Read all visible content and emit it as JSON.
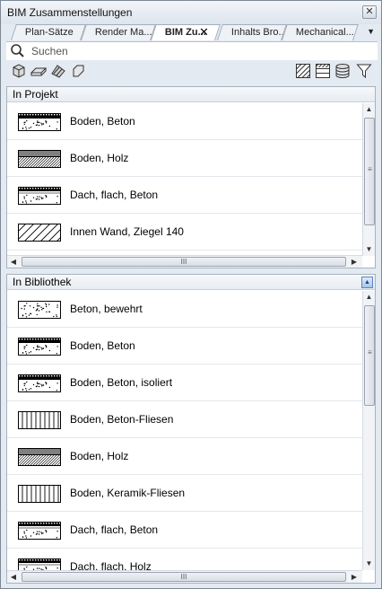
{
  "window": {
    "title": "BIM Zusammenstellungen",
    "close_glyph": "✕"
  },
  "tabs": [
    {
      "label": "Plan-Sätze"
    },
    {
      "label": "Render Ma..."
    },
    {
      "label": "BIM Zu..."
    },
    {
      "label": "Inhalts Bro..."
    },
    {
      "label": "Mechanical..."
    }
  ],
  "tab_close_glyph": "✕",
  "tab_menu_glyph": "▼",
  "search": {
    "placeholder": "Suchen"
  },
  "toolbar": {
    "left_icons": [
      "wall-icon",
      "slab-icon",
      "roof-icon",
      "custom-shape-icon"
    ],
    "right_icons": [
      "hatch-icon",
      "layers-icon",
      "database-icon",
      "filter-icon"
    ]
  },
  "project_panel": {
    "header": "In Projekt",
    "items": [
      {
        "label": "Boden, Beton",
        "pattern": "concrete-floor"
      },
      {
        "label": "Boden, Holz",
        "pattern": "wood-floor"
      },
      {
        "label": "Dach, flach, Beton",
        "pattern": "flat-roof"
      },
      {
        "label": "Innen Wand, Ziegel 140",
        "pattern": "brick-wall"
      }
    ]
  },
  "library_panel": {
    "header": "In Bibliothek",
    "collapse_glyph": "▲",
    "items": [
      {
        "label": "Beton, bewehrt",
        "pattern": "concrete"
      },
      {
        "label": "Boden, Beton",
        "pattern": "concrete-floor"
      },
      {
        "label": "Boden, Beton, isoliert",
        "pattern": "concrete-floor"
      },
      {
        "label": "Boden, Beton-Fliesen",
        "pattern": "tiles"
      },
      {
        "label": "Boden, Holz",
        "pattern": "wood-floor"
      },
      {
        "label": "Boden, Keramik-Fliesen",
        "pattern": "tiles"
      },
      {
        "label": "Dach, flach, Beton",
        "pattern": "flat-roof"
      },
      {
        "label": "Dach, flach, Holz",
        "pattern": "flat-roof"
      }
    ]
  },
  "scroll": {
    "up": "▲",
    "down": "▼",
    "left": "◀",
    "right": "▶",
    "grip": "III"
  }
}
